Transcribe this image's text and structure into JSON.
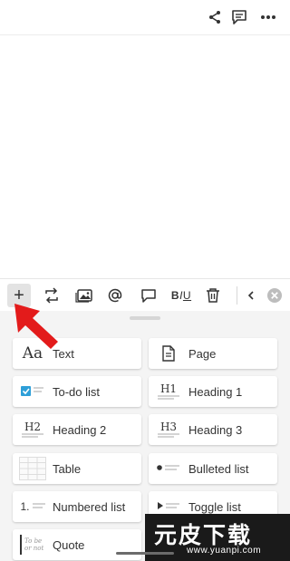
{
  "toolbar": {
    "plus_label": "+",
    "style_label": {
      "b": "B",
      "i": "I",
      "u": "U"
    }
  },
  "blocks": [
    {
      "label": "Text",
      "icon": "text-icon"
    },
    {
      "label": "Page",
      "icon": "page-icon"
    },
    {
      "label": "To-do list",
      "icon": "todo-icon"
    },
    {
      "label": "Heading 1",
      "icon": "heading1-icon"
    },
    {
      "label": "Heading 2",
      "icon": "heading2-icon"
    },
    {
      "label": "Heading 3",
      "icon": "heading3-icon"
    },
    {
      "label": "Table",
      "icon": "table-icon"
    },
    {
      "label": "Bulleted list",
      "icon": "bulleted-list-icon"
    },
    {
      "label": "Numbered list",
      "icon": "numbered-list-icon"
    },
    {
      "label": "Toggle list",
      "icon": "toggle-list-icon"
    },
    {
      "label": "Quote",
      "icon": "quote-icon"
    },
    {
      "label": "",
      "icon": "divider-icon"
    }
  ],
  "icon_text": {
    "text": "Aa",
    "heading1": "H1",
    "heading2": "H2",
    "heading3": "H3",
    "numbered": "1.",
    "quote": "To be or not"
  },
  "watermark": {
    "brand": "元皮下载",
    "site": "www.yuanpi.com"
  },
  "colors": {
    "accent": "#2e9fd8",
    "arrow": "#e31b1b",
    "sheet_bg": "#f4f4f4",
    "watermark_green": "#7fd23a"
  }
}
